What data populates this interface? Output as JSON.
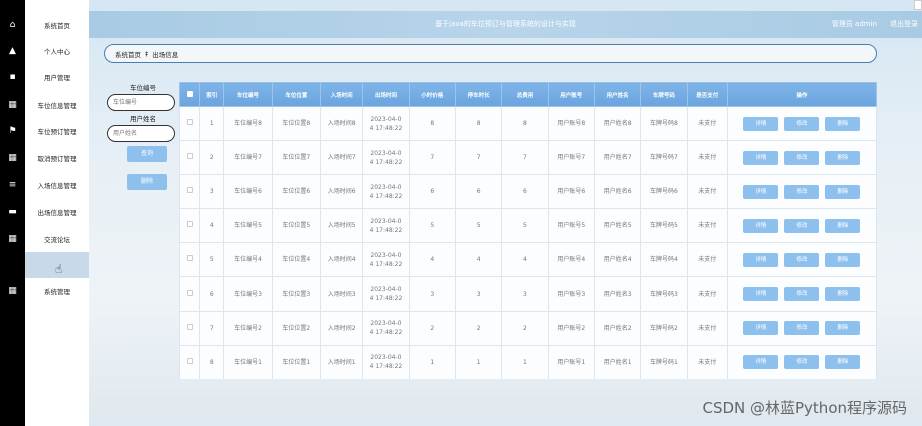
{
  "header": {
    "title": "基于java的车位预订与管理系统的设计与实现",
    "user_text": "管理员 admin",
    "logout_label": "退出登录"
  },
  "sidebar": {
    "items": [
      {
        "label": "系统首页",
        "icon": "home-icon",
        "glyph": "⌂"
      },
      {
        "label": "个人中心",
        "icon": "user-icon",
        "glyph": "▲"
      },
      {
        "label": "用户管理",
        "icon": "book-icon",
        "glyph": "▪"
      },
      {
        "label": "车位信息管理",
        "icon": "grid-icon",
        "glyph": "▦"
      },
      {
        "label": "车位预订管理",
        "icon": "flag-icon",
        "glyph": "⚑"
      },
      {
        "label": "取消预订管理",
        "icon": "grid-icon",
        "glyph": "▦"
      },
      {
        "label": "入场信息管理",
        "icon": "list-icon",
        "glyph": "≡"
      },
      {
        "label": "出场信息管理",
        "icon": "card-icon",
        "glyph": "▬"
      },
      {
        "label": "交流论坛",
        "icon": "grid-icon",
        "glyph": "▦"
      },
      {
        "label": "",
        "icon": "",
        "glyph": ""
      },
      {
        "label": "系统管理",
        "icon": "grid-icon",
        "glyph": "▦"
      }
    ]
  },
  "breadcrumb": {
    "home": "系统首页",
    "separator": "‡",
    "current": "出场信息"
  },
  "search": {
    "label1": "车位编号",
    "placeholder1": "车位编号",
    "label2": "用户姓名",
    "placeholder2": "用户姓名",
    "query_label": "查询",
    "delete_label": "删除"
  },
  "table": {
    "columns": [
      "",
      "索引",
      "车位编号",
      "车位位置",
      "入场时间",
      "出场时间",
      "小时价格",
      "停车时长",
      "总费用",
      "用户账号",
      "用户姓名",
      "车牌号码",
      "是否支付",
      "操作"
    ],
    "action_labels": {
      "detail": "详情",
      "edit": "修改",
      "delete": "删除"
    },
    "rows": [
      {
        "index": "1",
        "no": "车位编号8",
        "pos": "车位位置8",
        "in": "入场时间8",
        "out1": "2023-04-0",
        "out2": "4 17:48:22",
        "price": "8",
        "duration": "8",
        "total": "8",
        "account": "用户账号8",
        "name": "用户姓名8",
        "plate": "车牌号码8",
        "paid": "未支付"
      },
      {
        "index": "2",
        "no": "车位编号7",
        "pos": "车位位置7",
        "in": "入场时间7",
        "out1": "2023-04-0",
        "out2": "4 17:48:22",
        "price": "7",
        "duration": "7",
        "total": "7",
        "account": "用户账号7",
        "name": "用户姓名7",
        "plate": "车牌号码7",
        "paid": "未支付"
      },
      {
        "index": "3",
        "no": "车位编号6",
        "pos": "车位位置6",
        "in": "入场时间6",
        "out1": "2023-04-0",
        "out2": "4 17:48:22",
        "price": "6",
        "duration": "6",
        "total": "6",
        "account": "用户账号6",
        "name": "用户姓名6",
        "plate": "车牌号码6",
        "paid": "未支付"
      },
      {
        "index": "4",
        "no": "车位编号5",
        "pos": "车位位置5",
        "in": "入场时间5",
        "out1": "2023-04-0",
        "out2": "4 17:48:22",
        "price": "5",
        "duration": "5",
        "total": "5",
        "account": "用户账号5",
        "name": "用户姓名5",
        "plate": "车牌号码5",
        "paid": "未支付"
      },
      {
        "index": "5",
        "no": "车位编号4",
        "pos": "车位位置4",
        "in": "入场时间4",
        "out1": "2023-04-0",
        "out2": "4 17:48:22",
        "price": "4",
        "duration": "4",
        "total": "4",
        "account": "用户账号4",
        "name": "用户姓名4",
        "plate": "车牌号码4",
        "paid": "未支付"
      },
      {
        "index": "6",
        "no": "车位编号3",
        "pos": "车位位置3",
        "in": "入场时间3",
        "out1": "2023-04-0",
        "out2": "4 17:48:22",
        "price": "3",
        "duration": "3",
        "total": "3",
        "account": "用户账号3",
        "name": "用户姓名3",
        "plate": "车牌号码3",
        "paid": "未支付"
      },
      {
        "index": "7",
        "no": "车位编号2",
        "pos": "车位位置2",
        "in": "入场时间2",
        "out1": "2023-04-0",
        "out2": "4 17:48:22",
        "price": "2",
        "duration": "2",
        "total": "2",
        "account": "用户账号2",
        "name": "用户姓名2",
        "plate": "车牌号码2",
        "paid": "未支付"
      },
      {
        "index": "8",
        "no": "车位编号1",
        "pos": "车位位置1",
        "in": "入场时间1",
        "out1": "2023-04-0",
        "out2": "4 17:48:22",
        "price": "1",
        "duration": "1",
        "total": "1",
        "account": "用户账号1",
        "name": "用户姓名1",
        "plate": "车牌号码1",
        "paid": "未支付"
      }
    ]
  },
  "watermark": "CSDN @林蓝Python程序源码",
  "colors": {
    "accent": "#8ec0ee",
    "header_bg": "#a8cbe3",
    "table_header": "#6aa4de"
  }
}
